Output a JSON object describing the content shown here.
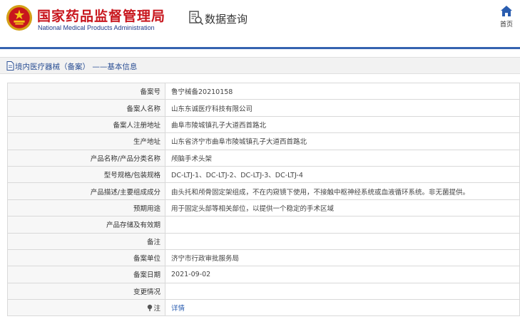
{
  "header": {
    "org_name": "国家药品监督管理局",
    "org_name_en": "National Medical Products Administration",
    "query_title": "数据查询",
    "home_label": "首页"
  },
  "breadcrumb": {
    "text": "境内医疗器械（备案） ——基本信息"
  },
  "detail": {
    "rows": [
      {
        "label": "备案号",
        "value": "鲁宁械备20210158"
      },
      {
        "label": "备案人名称",
        "value": "山东东诚医疗科技有限公司"
      },
      {
        "label": "备案人注册地址",
        "value": "曲阜市陵城镇孔子大道西首路北"
      },
      {
        "label": "生产地址",
        "value": "山东省济宁市曲阜市陵城镇孔子大道西首路北"
      },
      {
        "label": "产品名称/产品分类名称",
        "value": "颅脑手术头架"
      },
      {
        "label": "型号规格/包装规格",
        "value": "DC-LTJ-1、DC-LTJ-2、DC-LTJ-3、DC-LTJ-4"
      },
      {
        "label": "产品描述/主要组成成分",
        "value": "由头托和颅骨固定架组成，不在内窥镜下使用，不接触中枢神经系统或血液循环系统。非无菌提供。"
      },
      {
        "label": "预期用途",
        "value": "用于固定头部等相关部位，以提供一个稳定的手术区域"
      },
      {
        "label": "产品存储及有效期",
        "value": ""
      },
      {
        "label": "备注",
        "value": ""
      },
      {
        "label": "备案单位",
        "value": "济宁市行政审批服务局"
      },
      {
        "label": "备案日期",
        "value": "2021-09-02"
      },
      {
        "label": "变更情况",
        "value": ""
      },
      {
        "label": "注",
        "value": "详情"
      }
    ]
  },
  "colors": {
    "brand_red": "#c8161d",
    "brand_blue": "#3563b0",
    "link_blue": "#2a5db0"
  },
  "icons": [
    "national-emblem-icon",
    "search-document-icon",
    "home-icon",
    "document-icon",
    "note-bullet-icon"
  ]
}
